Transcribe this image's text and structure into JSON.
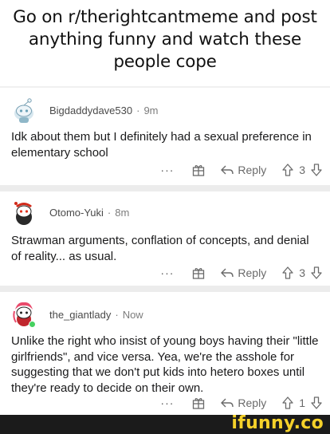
{
  "headline": "Go on r/therightcantmeme and post anything funny and watch these people cope",
  "comments": [
    {
      "username": "Bigdaddydave530",
      "separator": "·",
      "time": "9m",
      "text": "Idk about them but I definitely had a sexual preference in elementary school",
      "more": "···",
      "reply_label": "Reply",
      "score": "3"
    },
    {
      "username": "Otomo-Yuki",
      "separator": "·",
      "time": "8m",
      "text": "Strawman arguments, conflation of concepts, and denial of reality... as usual.",
      "more": "···",
      "reply_label": "Reply",
      "score": "3"
    },
    {
      "username": "the_giantlady",
      "separator": "·",
      "time": "Now",
      "text": "Unlike the right who insist of young boys having their \"little girlfriends\", and vice versa. Yea, we're the asshole for suggesting that we don't put kids into hetero boxes until they're ready to decide on their own.",
      "more": "···",
      "reply_label": "Reply",
      "score": "1"
    }
  ],
  "watermark": "ifunny.co",
  "colors": {
    "accent": "#f5d12a",
    "online": "#46d160",
    "divider": "#ececec"
  }
}
